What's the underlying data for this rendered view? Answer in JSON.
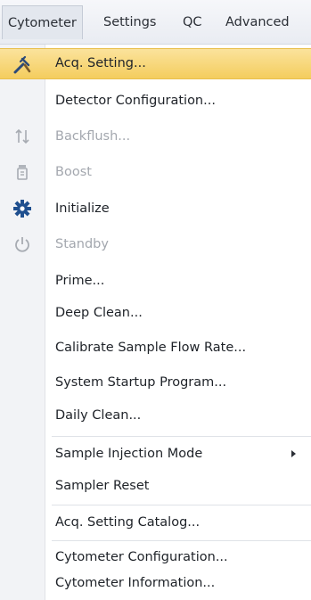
{
  "menubar": {
    "items": [
      {
        "label": "Cytometer"
      },
      {
        "label": "Settings"
      },
      {
        "label": "QC"
      },
      {
        "label": "Advanced"
      }
    ]
  },
  "menu": {
    "items": [
      {
        "label": "Acq. Setting...",
        "icon": "tools-icon",
        "state": "highlighted"
      },
      {
        "label": "Detector Configuration...",
        "state": "enabled"
      },
      {
        "label": "Backflush...",
        "icon": "backflush-icon",
        "state": "disabled"
      },
      {
        "label": "Boost",
        "icon": "boost-icon",
        "state": "disabled"
      },
      {
        "label": "Initialize",
        "icon": "gear-icon",
        "state": "enabled"
      },
      {
        "label": "Standby",
        "icon": "power-icon",
        "state": "disabled"
      },
      {
        "label": "Prime...",
        "state": "enabled"
      },
      {
        "label": "Deep Clean...",
        "state": "enabled"
      },
      {
        "label": "Calibrate Sample Flow Rate...",
        "state": "enabled"
      },
      {
        "label": "System Startup Program...",
        "state": "enabled"
      },
      {
        "label": "Daily Clean...",
        "state": "enabled"
      },
      {
        "label": "Sample Injection Mode",
        "state": "enabled",
        "submenu": true
      },
      {
        "label": "Sampler Reset",
        "state": "enabled"
      },
      {
        "label": "Acq. Setting Catalog...",
        "state": "enabled"
      },
      {
        "label": "Cytometer Configuration...",
        "state": "enabled"
      },
      {
        "label": "Cytometer Information...",
        "state": "enabled"
      }
    ]
  },
  "colors": {
    "highlight": "#f6d46f",
    "disabled_text": "#a3a7ae",
    "gear_blue": "#1f4f8f"
  }
}
